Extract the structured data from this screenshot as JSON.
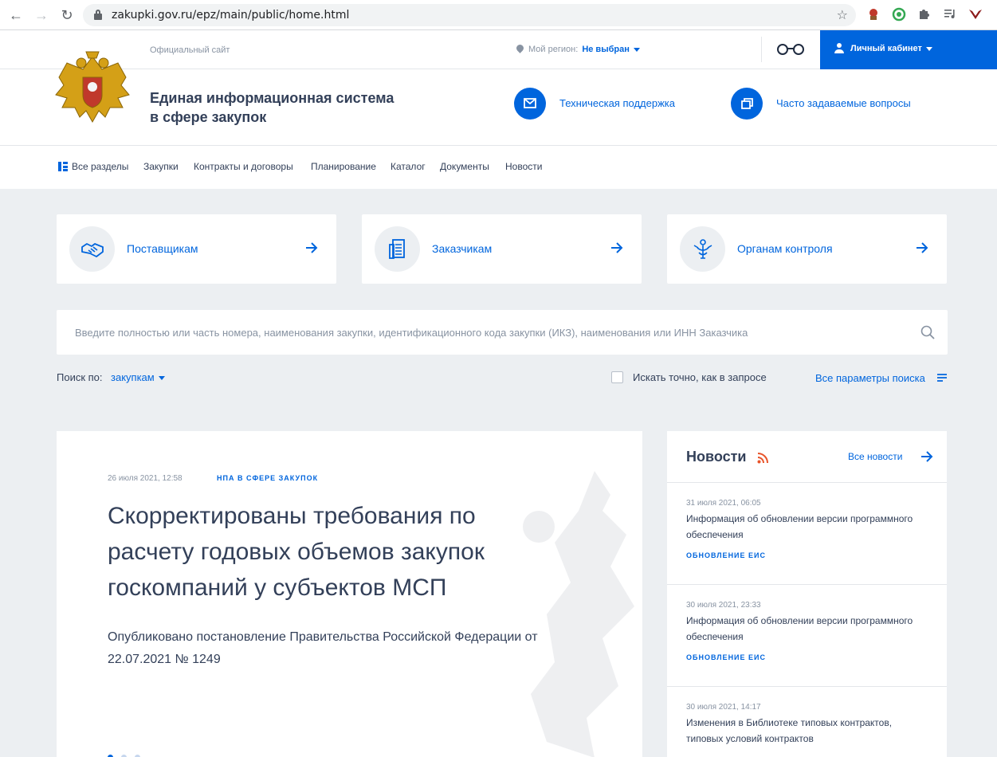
{
  "browser": {
    "url": "zakupki.gov.ru/epz/main/public/home.html"
  },
  "topbar": {
    "official": "Официальный сайт",
    "region_label": "Мой регион:",
    "region_value": "Не выбран",
    "cabinet": "Личный кабинет"
  },
  "header": {
    "title_line1": "Единая информационная система",
    "title_line2": "в сфере закупок",
    "support": "Техническая поддержка",
    "faq": "Часто задаваемые вопросы"
  },
  "menu": {
    "all": "Все разделы",
    "purchases": "Закупки",
    "contracts": "Контракты и договоры",
    "planning": "Планирование",
    "catalog": "Каталог",
    "documents": "Документы",
    "news": "Новости"
  },
  "cards": {
    "suppliers": "Поставщикам",
    "customers": "Заказчикам",
    "control": "Органам контроля"
  },
  "search": {
    "placeholder": "Введите полностью или часть номера, наименования закупки, идентификационного кода закупки (ИКЗ), наименования или ИНН Заказчика",
    "by_label": "Поиск по:",
    "by_value": "закупкам",
    "exact": "Искать точно, как в запросе",
    "all_params": "Все параметры поиска"
  },
  "hero": {
    "date": "26 июля 2021, 12:58",
    "tag": "НПА В СФЕРЕ ЗАКУПОК",
    "title": "Скорректированы требования по расчету годовых объемов закупок госкомпаний у субъектов МСП",
    "subtitle": "Опубликовано постановление Правительства Российской Федерации от 22.07.2021 № 1249"
  },
  "news": {
    "heading": "Новости",
    "all": "Все новости",
    "items": [
      {
        "date": "31 июля 2021, 06:05",
        "title": "Информация об обновлении версии программного обеспечения",
        "category": "ОБНОВЛЕНИЕ ЕИС"
      },
      {
        "date": "30 июля 2021, 23:33",
        "title": "Информация об обновлении версии программного обеспечения",
        "category": "ОБНОВЛЕНИЕ ЕИС"
      },
      {
        "date": "30 июля 2021, 14:17",
        "title": "Изменения в Библиотеке типовых контрактов, типовых условий контрактов",
        "category": ""
      }
    ]
  },
  "colors": {
    "accent": "#0065dd",
    "text": "#334059",
    "muted": "#8893a2",
    "background": "#eceff2"
  },
  "icons": [
    "back-arrow-icon",
    "forward-arrow-icon",
    "reload-icon",
    "lock-icon",
    "star-icon",
    "puzzle-icon",
    "glasses-icon",
    "user-icon",
    "mail-icon",
    "windows-icon",
    "grid-icon",
    "handshake-icon",
    "document-icon",
    "emblem-icon",
    "arrow-right-icon",
    "search-icon",
    "filter-icon",
    "rss-icon"
  ]
}
